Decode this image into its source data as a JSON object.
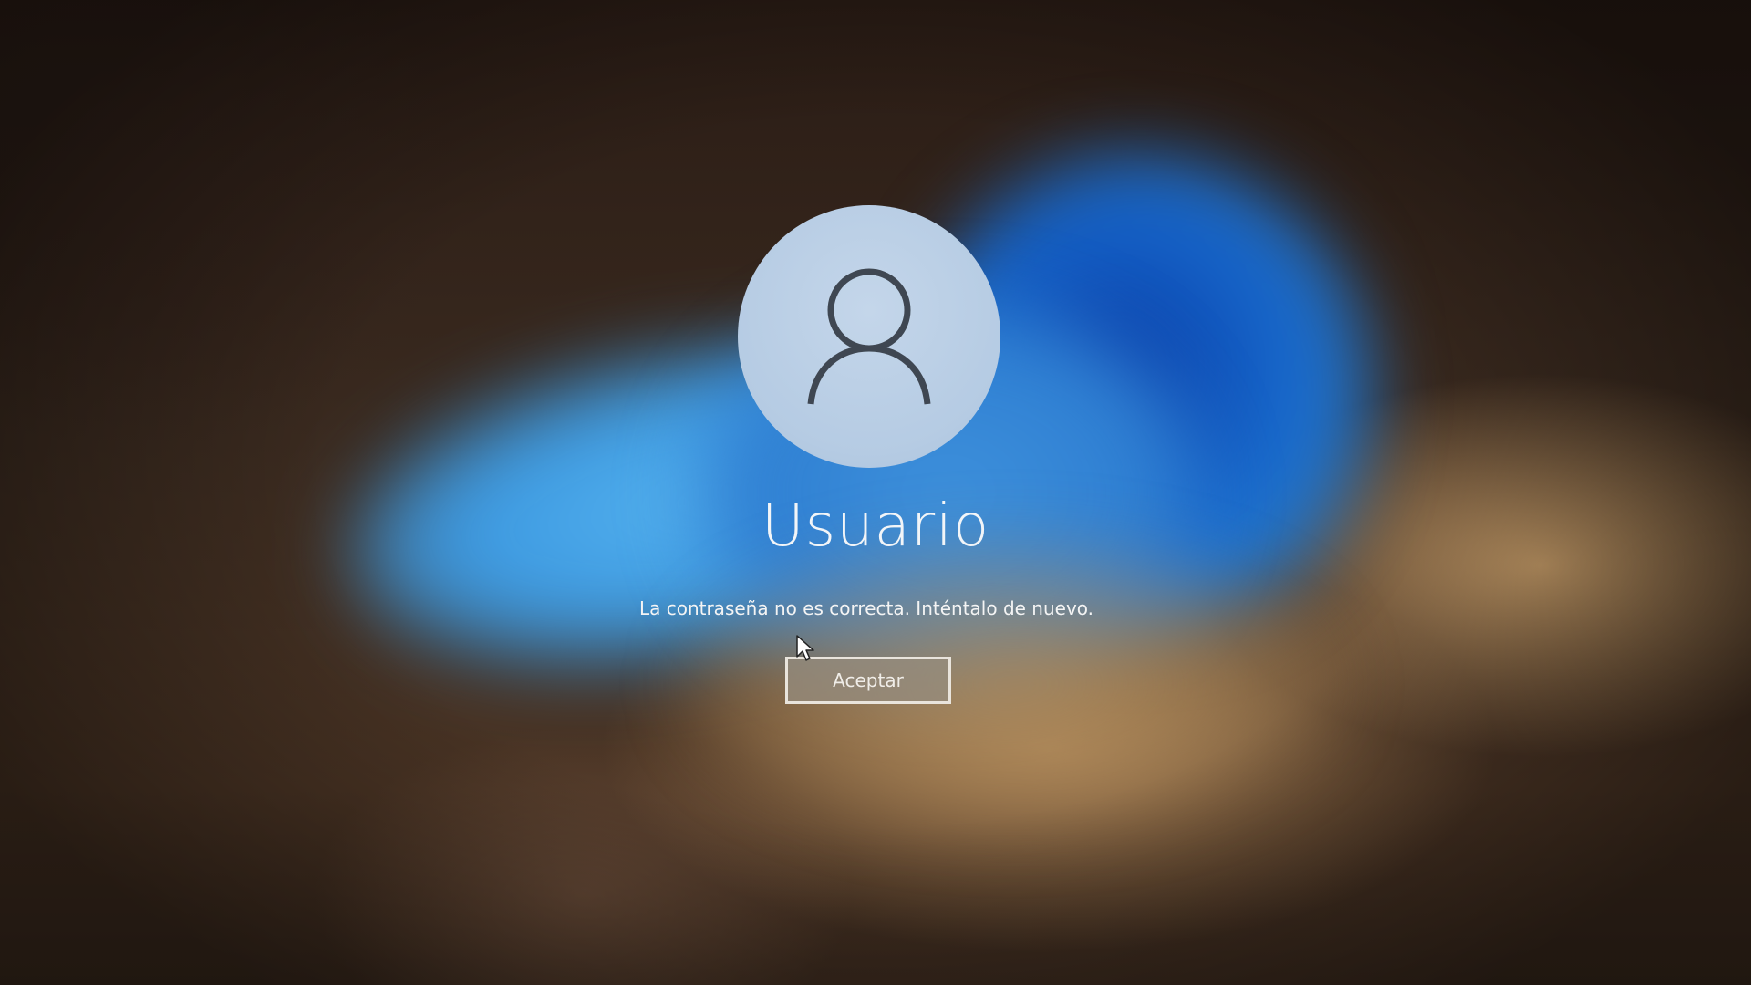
{
  "lock_screen": {
    "avatar_icon": "user-icon",
    "username": "Usuario",
    "error_message": "La contraseña no es correcta. Inténtalo de nuevo.",
    "ok_button_label": "Aceptar"
  },
  "colors": {
    "avatar_fill": "#b5cbe3",
    "text": "#f2f5f8",
    "button_border": "#e9e4dc"
  }
}
